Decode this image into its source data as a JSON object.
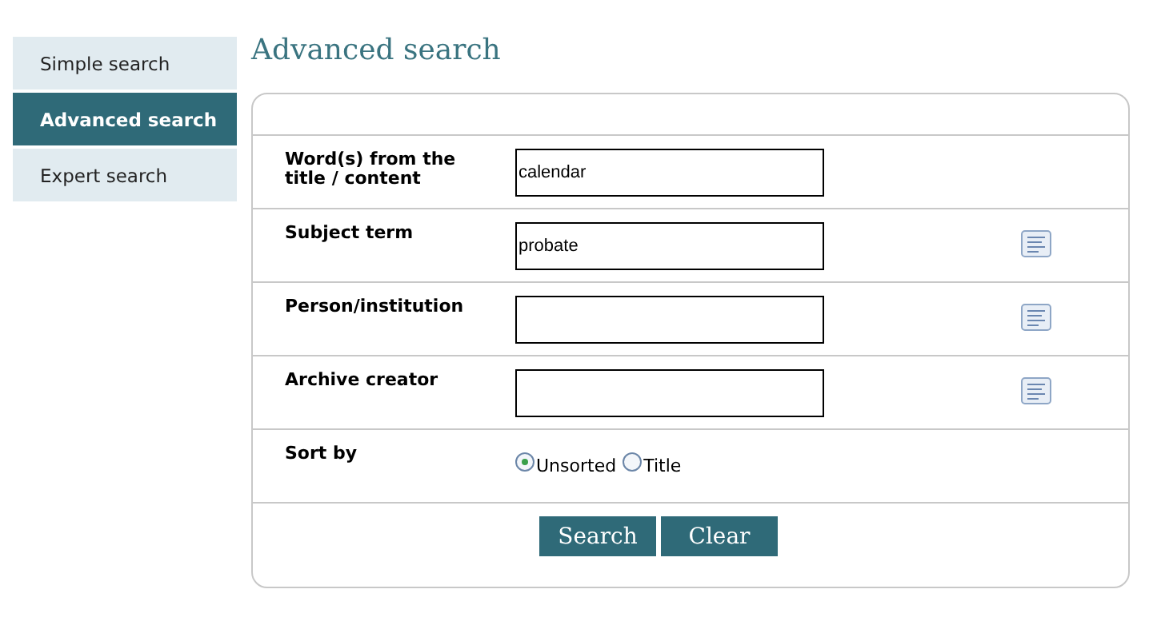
{
  "sidebar": {
    "items": [
      {
        "label": "Simple search",
        "selected": false
      },
      {
        "label": "Advanced search",
        "selected": true
      },
      {
        "label": "Expert search",
        "selected": false
      }
    ]
  },
  "heading": "Advanced search",
  "form": {
    "rows": [
      {
        "kind": "text",
        "label": "Word(s) from the title / content",
        "value": "calendar",
        "lookup": false
      },
      {
        "kind": "text",
        "label": "Subject term",
        "value": "probate",
        "lookup": true
      },
      {
        "kind": "text",
        "label": "Person/institution",
        "lookup": true
      },
      {
        "kind": "text",
        "label": "Archive creator",
        "lookup": true
      },
      {
        "kind": "radio",
        "label": "Sort by",
        "options": [
          {
            "label": "Unsorted",
            "selected": true
          },
          {
            "label": "Title",
            "selected": false
          }
        ]
      }
    ],
    "buttons": [
      "Search",
      "Clear"
    ]
  }
}
